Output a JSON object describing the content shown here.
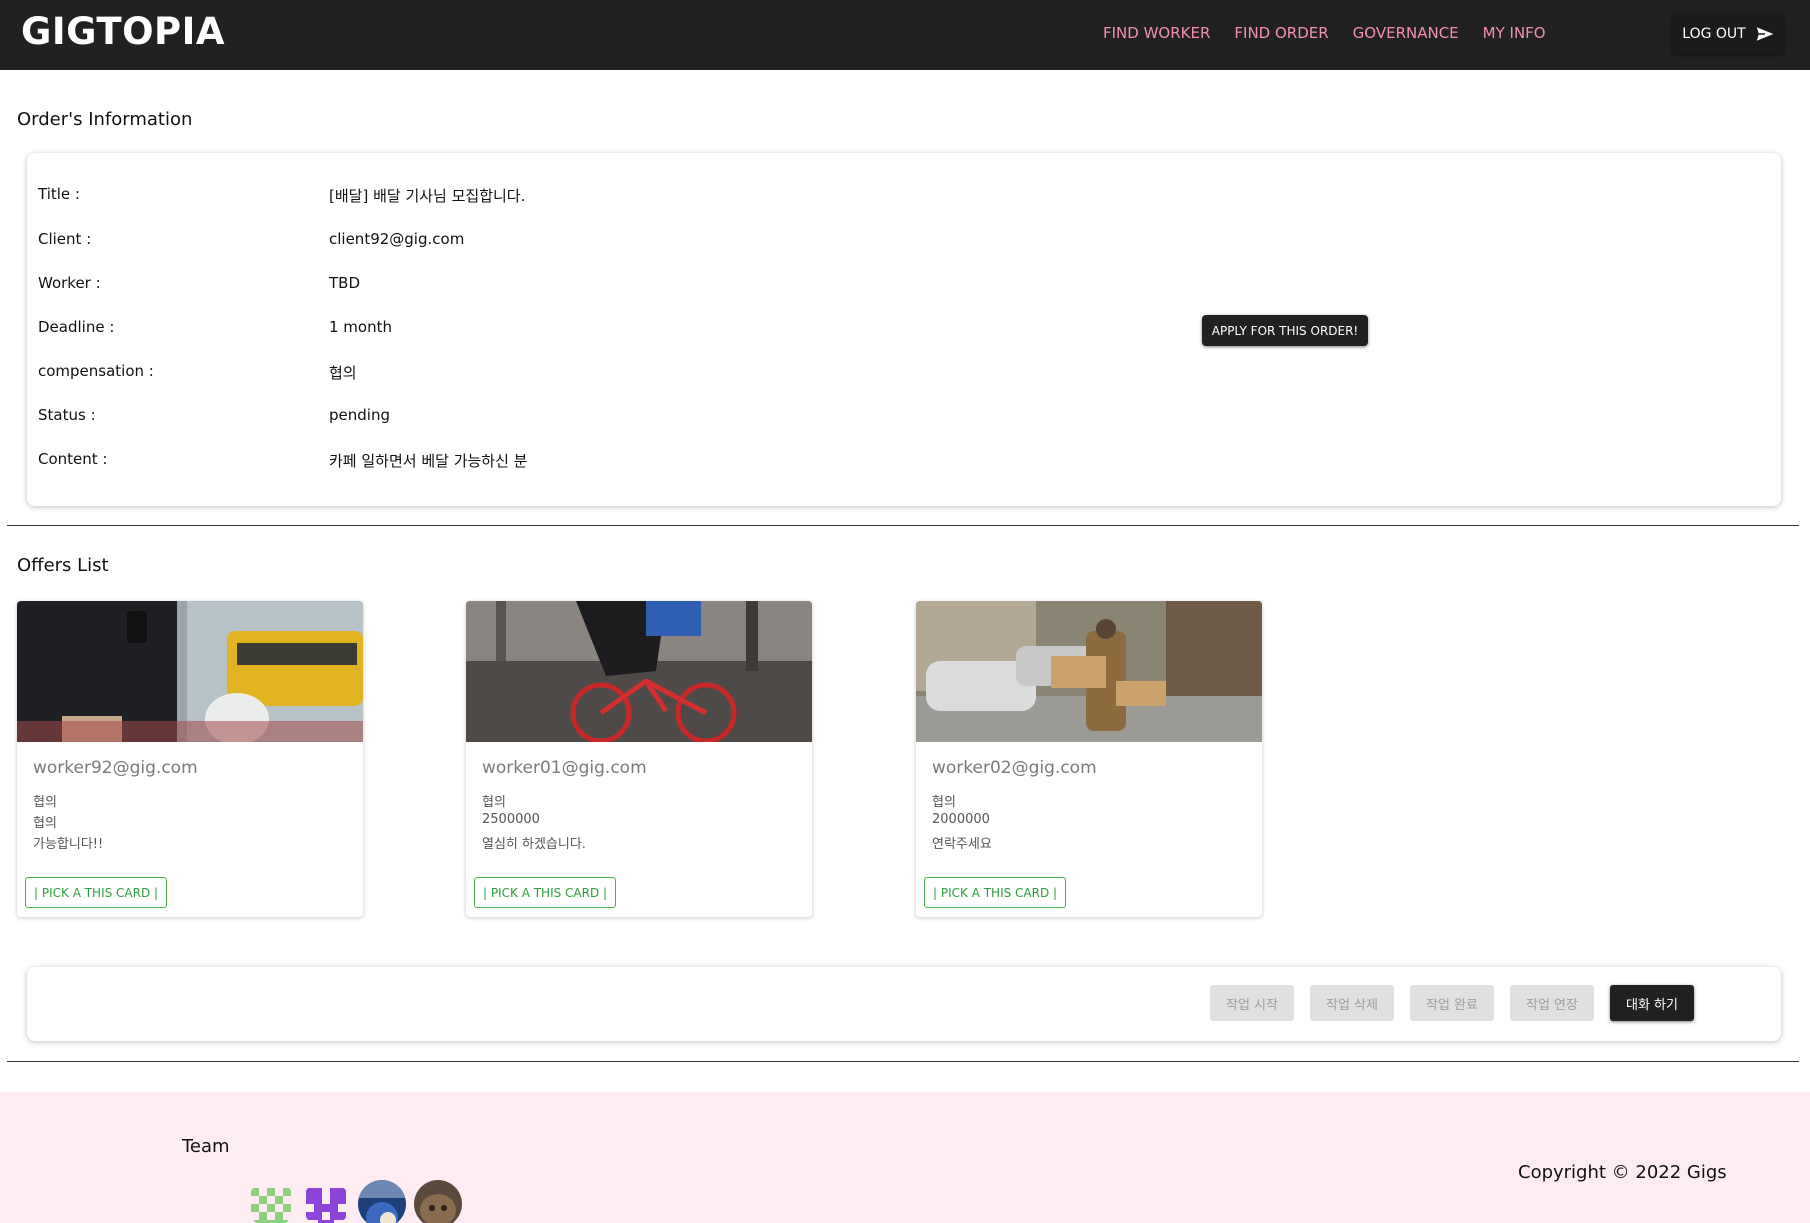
{
  "header": {
    "brand": "GIGTOPIA",
    "nav": [
      "FIND WORKER",
      "FIND ORDER",
      "GOVERNANCE",
      "MY INFO"
    ],
    "logout_label": "LOG OUT"
  },
  "order": {
    "heading": "Order's Information",
    "rows": [
      {
        "label": "Title :",
        "value": "[배달] 배달 기사님 모집합니다."
      },
      {
        "label": "Client :",
        "value": "client92@gig.com"
      },
      {
        "label": "Worker :",
        "value": "TBD"
      },
      {
        "label": "Deadline :",
        "value": "1 month"
      },
      {
        "label": "compensation :",
        "value": "협의"
      },
      {
        "label": "Status :",
        "value": "pending"
      },
      {
        "label": "Content :",
        "value": "카페 일하면서 베달 가능하신 분"
      }
    ],
    "apply_label": "APPLY FOR THIS ORDER!"
  },
  "offers": {
    "heading": "Offers List",
    "items": [
      {
        "email": "worker92@gig.com",
        "lines": [
          "협의",
          "협의",
          "가능합니다!!"
        ],
        "pick_label": "| PICK A THIS CARD |"
      },
      {
        "email": "worker01@gig.com",
        "lines": [
          "협의",
          "2500000",
          "열심히 하겠습니다."
        ],
        "pick_label": "| PICK A THIS CARD |"
      },
      {
        "email": "worker02@gig.com",
        "lines": [
          "협의",
          "2000000",
          "연락주세요"
        ],
        "pick_label": "| PICK A THIS CARD |"
      }
    ]
  },
  "actions": {
    "start": "작업 시작",
    "delete": "작업 삭제",
    "complete": "작업 완료",
    "extend": "작업 연장",
    "chat": "대화 하기"
  },
  "footer": {
    "team_label": "Team",
    "copyright": "Copyright © 2022 Gigs"
  },
  "colors": {
    "header_bg": "#212121",
    "nav_accent": "#f48fb1",
    "pick_green": "#4caf50",
    "footer_bg": "#fdedf2"
  }
}
